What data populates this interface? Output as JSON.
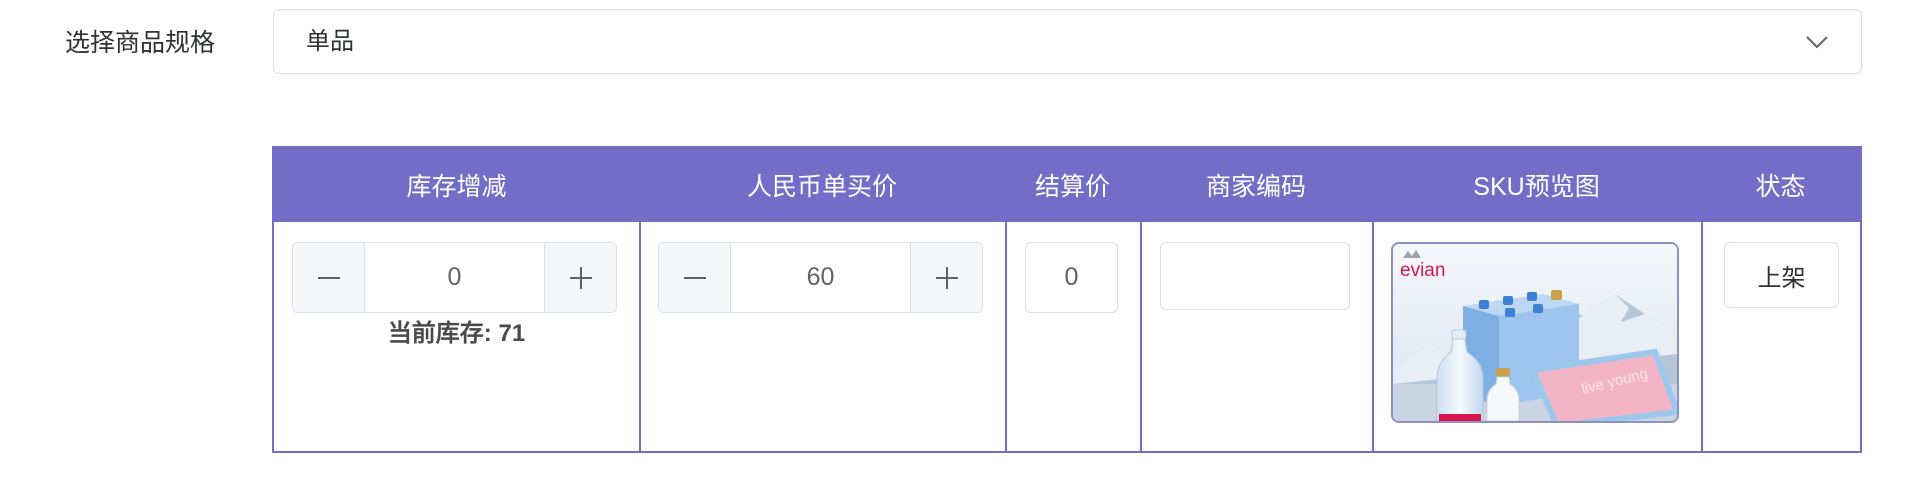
{
  "colors": {
    "accent": "#736dc8",
    "border": "#dcdfe6",
    "text": "#303133",
    "stepper_bg": "#f5f7fa"
  },
  "spec": {
    "label": "选择商品规格",
    "selected": "单品",
    "icon": "chevron-down-icon"
  },
  "table": {
    "headers": {
      "stock_delta": "库存增减",
      "price": "人民币单买价",
      "settlement": "结算价",
      "merchant_code": "商家编码",
      "sku_preview": "SKU预览图",
      "status": "状态"
    },
    "row": {
      "stock_delta": {
        "decrement_icon": "minus-icon",
        "value": "0",
        "increment_icon": "plus-icon",
        "current_stock": "当前库存: 71"
      },
      "price": {
        "decrement_icon": "minus-icon",
        "value": "60",
        "increment_icon": "plus-icon"
      },
      "settlement": {
        "value": "0"
      },
      "merchant_code": {
        "value": ""
      },
      "sku_preview": {
        "logo_text": "evian",
        "box_text": "live young"
      },
      "status": {
        "button_label": "上架"
      }
    }
  }
}
